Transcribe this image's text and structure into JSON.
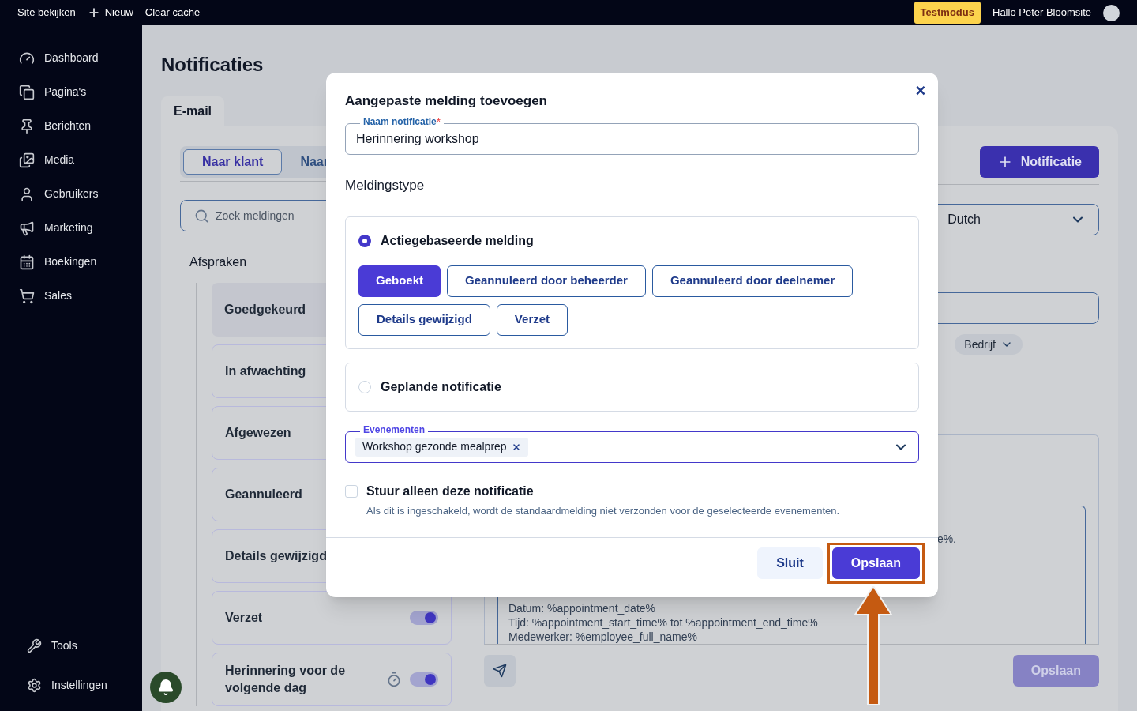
{
  "top_bar": {
    "links": [
      {
        "label": "Site bekijken",
        "kind": "link"
      },
      {
        "label": "Nieuw",
        "kind": "add"
      },
      {
        "label": "Clear cache",
        "kind": "link"
      }
    ],
    "badge": "Testmodus",
    "greeting": "Hallo Peter Bloomsite"
  },
  "sidebar": {
    "items": [
      {
        "label": "Dashboard"
      },
      {
        "label": "Pagina's"
      },
      {
        "label": "Berichten"
      },
      {
        "label": "Media"
      },
      {
        "label": "Gebruikers"
      },
      {
        "label": "Marketing"
      },
      {
        "label": "Boekingen"
      },
      {
        "label": "Sales"
      }
    ],
    "bottom_items": [
      {
        "label": "Tools"
      },
      {
        "label": "Instellingen"
      }
    ]
  },
  "page": {
    "title": "Notificaties",
    "tabs": [
      {
        "label": "E-mail",
        "selected": true
      }
    ],
    "audience_tabs": [
      {
        "label": "Naar klant",
        "selected": true
      },
      {
        "label": "Naar",
        "selected": false
      }
    ],
    "search": {
      "placeholder": "Zoek meldingen"
    },
    "section": "Afspraken",
    "notifications": [
      {
        "label": "Goedgekeurd",
        "selected": true,
        "kind": "plain"
      },
      {
        "label": "In afwachting",
        "selected": false,
        "kind": "plain"
      },
      {
        "label": "Afgewezen",
        "selected": false,
        "kind": "plain"
      },
      {
        "label": "Geannuleerd",
        "selected": false,
        "kind": "plain"
      },
      {
        "label": "Details gewijzigd",
        "selected": false,
        "kind": "plain"
      },
      {
        "label": "Verzet",
        "selected": false,
        "kind": "toggle",
        "on": true
      },
      {
        "label": "Herinnering voor de volgende dag",
        "selected": false,
        "kind": "timed",
        "on": true
      }
    ],
    "add_button": "Notificatie",
    "language": "Dutch",
    "chip": "Bedrijf",
    "editor_lines": [
      "e%.",
      "Datum: %appointment_date%",
      "Tijd: %appointment_start_time% tot %appointment_end_time%",
      "Medewerker: %employee_full_name%"
    ],
    "save_button": {
      "label": "Opslaan",
      "disabled": true
    }
  },
  "modal": {
    "title": "Aangepaste melding toevoegen",
    "close": "×",
    "name_field": {
      "label": "Naam notificatie",
      "required_mark": "*",
      "value": "Herinnering workshop"
    },
    "section": "Meldingstype",
    "options": [
      {
        "label": "Actiegebaseerde melding",
        "selected": true,
        "triggers": [
          {
            "label": "Geboekt",
            "selected": true
          },
          {
            "label": "Geannuleerd door beheerder",
            "selected": false
          },
          {
            "label": "Geannuleerd door deelnemer",
            "selected": false
          },
          {
            "label": "Details gewijzigd",
            "selected": false
          },
          {
            "label": "Verzet",
            "selected": false
          }
        ]
      },
      {
        "label": "Geplande notificatie",
        "selected": false
      }
    ],
    "events_field": {
      "label": "Evenementen",
      "tags": [
        "Workshop gezonde mealprep"
      ]
    },
    "only_this": {
      "label": "Stuur alleen deze notificatie",
      "description": "Als dit is ingeschakeld, wordt de standaardmelding niet verzonden voor de geselecteerde evenementen.",
      "checked": false
    },
    "buttons": [
      {
        "label": "Sluit",
        "kind": "secondary"
      },
      {
        "label": "Opslaan",
        "kind": "primary",
        "highlighted": true
      }
    ]
  }
}
